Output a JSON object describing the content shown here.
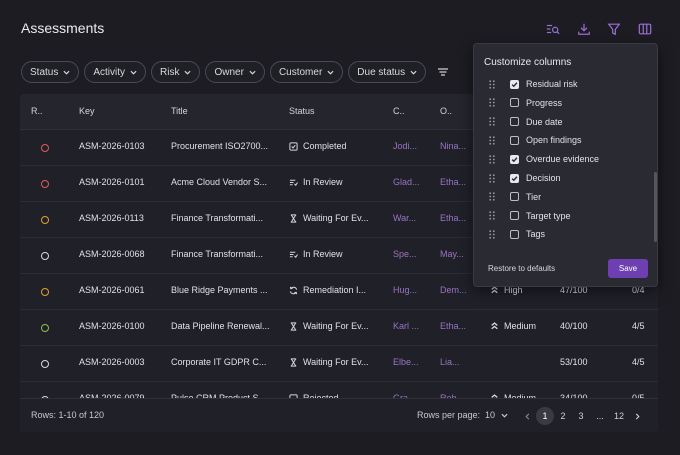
{
  "header": {
    "title": "Assessments"
  },
  "toolbar": {
    "icons": [
      "search-list-icon",
      "download-icon",
      "filter-icon",
      "columns-icon"
    ],
    "accent": "#9a6fd6"
  },
  "filters": [
    "Status",
    "Activity",
    "Risk",
    "Owner",
    "Customer",
    "Due status"
  ],
  "table": {
    "columns": [
      "R..",
      "Key",
      "Title",
      "Status",
      "C..",
      "O.."
    ],
    "rows": [
      {
        "risk_color": "#e05a5a",
        "key": "ASM-2026-0103",
        "title": "Procurement ISO2700...",
        "status": "Completed",
        "status_icon": "check-box-icon",
        "customer": "Jodi...",
        "owner": "Nina...",
        "risk_level": "",
        "score": "",
        "findings": ""
      },
      {
        "risk_color": "#e05a5a",
        "key": "ASM-2026-0101",
        "title": "Acme Cloud Vendor S...",
        "status": "In Review",
        "status_icon": "review-lines-icon",
        "customer": "Glad...",
        "owner": "Etha...",
        "risk_level": "",
        "score": "",
        "findings": ""
      },
      {
        "risk_color": "#e0a030",
        "key": "ASM-2026-0113",
        "title": "Finance Transformati...",
        "status": "Waiting For Ev...",
        "status_icon": "hourglass-icon",
        "customer": "War...",
        "owner": "Etha...",
        "risk_level": "",
        "score": "",
        "findings": ""
      },
      {
        "risk_color": "#d8d8de",
        "key": "ASM-2026-0068",
        "title": "Finance Transformati...",
        "status": "In Review",
        "status_icon": "review-lines-icon",
        "customer": "Spe...",
        "owner": "May...",
        "risk_level": "",
        "score": "",
        "findings": ""
      },
      {
        "risk_color": "#e0a030",
        "key": "ASM-2026-0061",
        "title": "Blue Ridge Payments ...",
        "status": "Remediation I...",
        "status_icon": "refresh-icon",
        "customer": "Hug...",
        "owner": "Dem...",
        "risk_level": "High",
        "score": "47/100",
        "findings": "0/4"
      },
      {
        "risk_color": "#8cc050",
        "key": "ASM-2026-0100",
        "title": "Data Pipeline Renewal...",
        "status": "Waiting For Ev...",
        "status_icon": "hourglass-icon",
        "customer": "Karl ...",
        "owner": "Etha...",
        "risk_level": "Medium",
        "score": "40/100",
        "findings": "4/5"
      },
      {
        "risk_color": "#d8d8de",
        "key": "ASM-2026-0003",
        "title": "Corporate IT GDPR C...",
        "status": "Waiting For Ev...",
        "status_icon": "hourglass-icon",
        "customer": "Elbe...",
        "owner": "Lia...",
        "risk_level": "",
        "score": "53/100",
        "findings": "4/5"
      },
      {
        "risk_color": "#d8d8de",
        "key": "ASM-2026-0079",
        "title": "Pulse CRM Product S...",
        "status": "Rejected",
        "status_icon": "rejected-icon",
        "customer": "Gra...",
        "owner": "Rob...",
        "risk_level": "Medium",
        "score": "34/100",
        "findings": "0/5"
      }
    ],
    "footer": {
      "rows_text": "Rows: 1-10 of 120",
      "rows_per_page_label": "Rows per page:",
      "rows_per_page_value": "10",
      "pages": [
        "1",
        "2",
        "3",
        "...",
        "12"
      ],
      "active_page": "1"
    }
  },
  "columns_panel": {
    "title": "Customize columns",
    "items": [
      {
        "label": "Residual risk",
        "checked": true
      },
      {
        "label": "Progress",
        "checked": false
      },
      {
        "label": "Due date",
        "checked": false
      },
      {
        "label": "Open findings",
        "checked": false
      },
      {
        "label": "Overdue evidence",
        "checked": true
      },
      {
        "label": "Decision",
        "checked": true
      },
      {
        "label": "Tier",
        "checked": false
      },
      {
        "label": "Target type",
        "checked": false
      },
      {
        "label": "Tags",
        "checked": false
      }
    ],
    "restore_label": "Restore to defaults",
    "save_label": "Save",
    "save_color": "#6e3fb0"
  }
}
